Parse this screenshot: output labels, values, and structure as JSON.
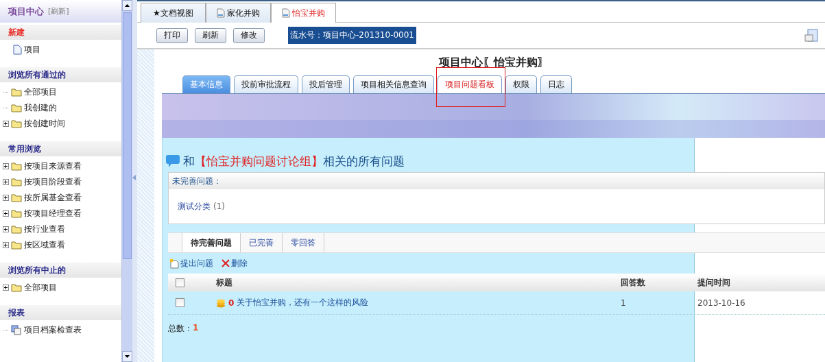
{
  "sidebar": {
    "title": "项目中心",
    "refresh": "[刷新]",
    "sections": [
      {
        "title": "新建",
        "kind": "new",
        "items": [
          {
            "label": "项目",
            "kind": "page"
          }
        ]
      },
      {
        "title": "浏览所有通过的",
        "kind": "browse",
        "items": [
          {
            "label": "全部项目",
            "kind": "folder",
            "expandable": false
          },
          {
            "label": "我创建的",
            "kind": "folder",
            "expandable": false
          },
          {
            "label": "按创建时间",
            "kind": "folder",
            "expandable": true
          }
        ]
      },
      {
        "title": "常用浏览",
        "kind": "browse",
        "items": [
          {
            "label": "按项目来源查看",
            "kind": "folder",
            "expandable": true
          },
          {
            "label": "按项目阶段查看",
            "kind": "folder",
            "expandable": true
          },
          {
            "label": "按所属基金查看",
            "kind": "folder",
            "expandable": true
          },
          {
            "label": "按项目经理查看",
            "kind": "folder",
            "expandable": true
          },
          {
            "label": "按行业查看",
            "kind": "folder",
            "expandable": true
          },
          {
            "label": "按区域查看",
            "kind": "folder",
            "expandable": true
          }
        ]
      },
      {
        "title": "浏览所有中止的",
        "kind": "browse",
        "items": [
          {
            "label": "全部项目",
            "kind": "folder",
            "expandable": true
          }
        ]
      },
      {
        "title": "报表",
        "kind": "browse",
        "items": [
          {
            "label": "项目档案检查表",
            "kind": "report",
            "expandable": false
          }
        ]
      }
    ]
  },
  "doc_tabs": [
    {
      "label": "★文档视图",
      "kind": "plain",
      "selected": false
    },
    {
      "label": "家化并购",
      "kind": "doc",
      "selected": false
    },
    {
      "label": "怡宝并购",
      "kind": "doc",
      "selected": true
    }
  ],
  "toolbar": {
    "buttons": [
      "打印",
      "刷新",
      "修改"
    ],
    "serial": "流水号：项目中心-201310-0001"
  },
  "page_title": "项目中心〖怡宝并购〗",
  "tabs": [
    {
      "label": "基本信息",
      "highlighted": true,
      "selected": false,
      "annotated": false
    },
    {
      "label": "投前审批流程",
      "highlighted": false,
      "selected": false,
      "annotated": false
    },
    {
      "label": "投后管理",
      "highlighted": false,
      "selected": false,
      "annotated": false
    },
    {
      "label": "项目相关信息查询",
      "highlighted": false,
      "selected": false,
      "annotated": false
    },
    {
      "label": "项目问题看板",
      "highlighted": false,
      "selected": true,
      "annotated": true
    },
    {
      "label": "权限",
      "highlighted": false,
      "selected": false,
      "annotated": false
    },
    {
      "label": "日志",
      "highlighted": false,
      "selected": false,
      "annotated": false
    }
  ],
  "heading": {
    "prefix": "和",
    "group": "【怡宝并购问题讨论组】",
    "suffix": "相关的所有问题"
  },
  "unresolved": {
    "title": "未完善问题：",
    "categories": [
      {
        "label": "测试分类",
        "count": "(1)"
      }
    ]
  },
  "question_tabs": [
    {
      "label": "待完善问题",
      "selected": true
    },
    {
      "label": "已完善",
      "selected": false
    },
    {
      "label": "零回答",
      "selected": false
    }
  ],
  "actions": [
    {
      "label": "提出问题",
      "kind": "new"
    },
    {
      "label": "删除",
      "kind": "delete"
    }
  ],
  "table": {
    "columns": [
      "标题",
      "回答数",
      "提问时间"
    ],
    "header_checked": false,
    "rows": [
      {
        "checked": false,
        "points": "0",
        "title": "关于怡宝并购，还有一个这样的风险",
        "answers": "1",
        "date": "2013-10-16"
      }
    ]
  },
  "total": {
    "label": "总数：",
    "value": "1"
  }
}
